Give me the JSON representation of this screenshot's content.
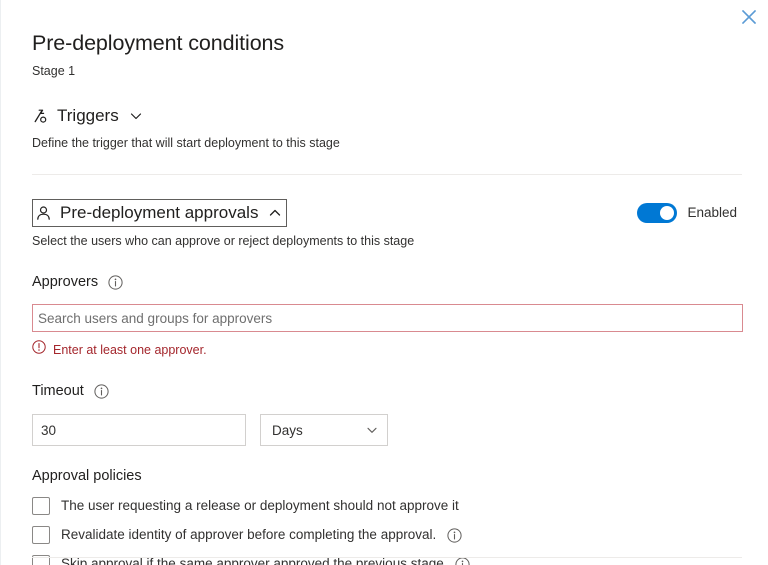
{
  "panel": {
    "close_icon": "close-icon",
    "title": "Pre-deployment conditions",
    "stage": "Stage 1"
  },
  "triggers": {
    "icon": "trigger-fork-icon",
    "title": "Triggers",
    "chevron": "chevron-down-icon",
    "description": "Define the trigger that will start deployment to this stage"
  },
  "approvals": {
    "icon": "person-icon",
    "title": "Pre-deployment approvals",
    "chevron": "chevron-up-icon",
    "description": "Select the users who can approve or reject deployments to this stage",
    "toggle": {
      "state": "on",
      "label": "Enabled",
      "accent_color": "#0078d4"
    },
    "approvers": {
      "label": "Approvers",
      "info_icon": "info-icon",
      "placeholder": "Search users and groups for approvers",
      "value": "",
      "error_icon": "error-circle-icon",
      "error_text": "Enter at least one approver.",
      "error_color": "#a4262c",
      "border_color": "#d98a90"
    },
    "timeout": {
      "label": "Timeout",
      "info_icon": "info-icon",
      "value": "30",
      "unit": "Days",
      "unit_chevron": "chevron-down-icon"
    },
    "policies": {
      "title": "Approval policies",
      "items": [
        {
          "label": "The user requesting a release or deployment should not approve it",
          "checked": false,
          "has_info": false
        },
        {
          "label": "Revalidate identity of approver before completing the approval.",
          "checked": false,
          "has_info": true
        },
        {
          "label": "Skip approval if the same approver approved the previous stage",
          "checked": false,
          "has_info": true
        }
      ]
    }
  }
}
